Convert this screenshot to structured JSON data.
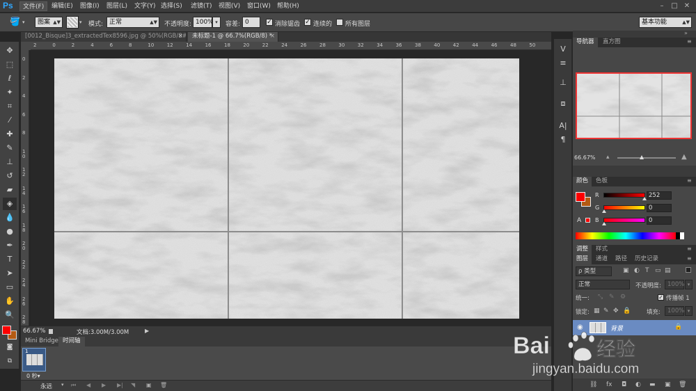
{
  "app": {
    "logo": "Ps"
  },
  "menu": [
    "文件(F)",
    "编辑(E)",
    "图像(I)",
    "图层(L)",
    "文字(Y)",
    "选择(S)",
    "滤镜(T)",
    "视图(V)",
    "窗口(W)",
    "帮助(H)"
  ],
  "options": {
    "fill_source": "图案",
    "mode_label": "模式:",
    "mode_value": "正常",
    "opacity_label": "不透明度:",
    "opacity_value": "100%",
    "tolerance_label": "容差:",
    "tolerance_value": "0",
    "antialias_label": "消除锯齿",
    "contiguous_label": "连续的",
    "all_layers_label": "所有图层",
    "workspace": "基本功能"
  },
  "tabs": [
    {
      "label": "[0012_Bisque]3_extractedTex8596.jpg @ 50%(RGB/8#)",
      "close": "×"
    },
    {
      "label": "未标题-1 @ 66.7%(RGB/8) *",
      "close": "×"
    }
  ],
  "ruler_h": [
    "2",
    "0",
    "2",
    "4",
    "6",
    "8",
    "10",
    "12",
    "14",
    "16",
    "18",
    "20",
    "22",
    "24",
    "26",
    "28",
    "30",
    "32",
    "34",
    "36",
    "38",
    "40",
    "42",
    "44",
    "46",
    "48",
    "50"
  ],
  "ruler_v": [
    "0",
    "2",
    "4",
    "6",
    "8",
    "1 0",
    "1 2",
    "1 4",
    "1 6",
    "1 8",
    "2 0",
    "2 2",
    "2 4",
    "2 6",
    "2 8"
  ],
  "status": {
    "zoom": "66.67%",
    "doc": "文档:3.00M/3.00M"
  },
  "bottom": {
    "tabs": [
      "Mini Bridge",
      "时间轴"
    ],
    "frame_number": "1",
    "frame_delay": "0 秒▾",
    "loop": "永远"
  },
  "navigator": {
    "tabs": [
      "导航器",
      "直方图"
    ],
    "zoom": "66.67%"
  },
  "color_panel": {
    "tabs": [
      "颜色",
      "色板"
    ],
    "r_label": "R",
    "r_value": "252",
    "g_label": "G",
    "g_value": "0",
    "b_label": "B",
    "b_value": "0",
    "fg_color": "#fc0000",
    "bg_color": "#b45a12"
  },
  "adjust_tabs": [
    "调整",
    "样式"
  ],
  "layers": {
    "tabs": [
      "图层",
      "通道",
      "路径",
      "历史记录"
    ],
    "filter": "ρ 类型",
    "blend": "正常",
    "opacity_label": "不透明度:",
    "opacity_value": "100%",
    "unify_label": "统一:",
    "propagate_label": "传播帧 1",
    "lock_label": "锁定:",
    "fill_label": "填充:",
    "fill_value": "100%",
    "layer_name": "背景"
  },
  "watermark": {
    "brand": "Bai",
    "brand2": "经验",
    "url": "jingyan.baidu.com"
  }
}
